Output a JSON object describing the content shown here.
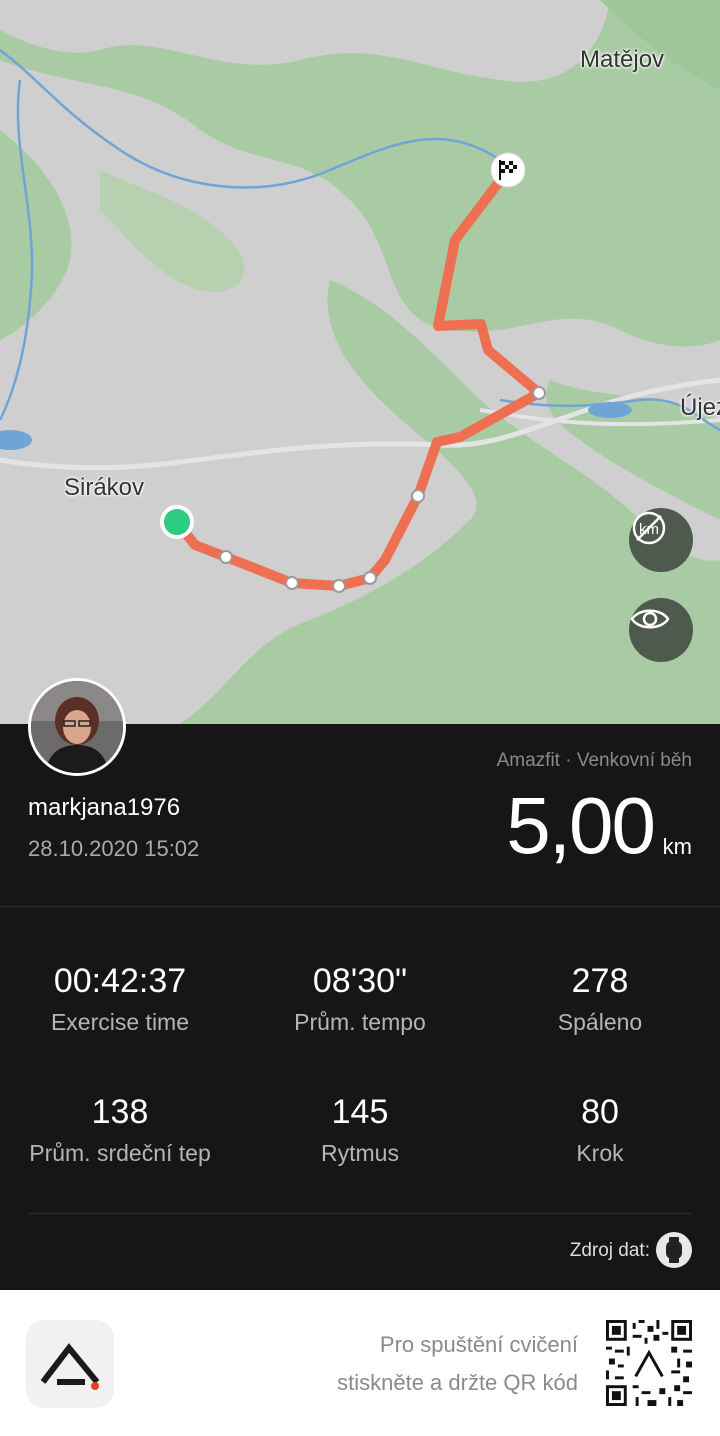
{
  "map": {
    "labels": {
      "matejov": "Matějov",
      "sirakov": "Sirákov",
      "ujezd": "Újez"
    },
    "route_color": "#ef6f52",
    "start_color": "#2ecc80",
    "finish_icon": "checkered-flag-icon",
    "buttons": {
      "km_toggle_icon": "km-markers-off-icon",
      "visibility_icon": "eye-icon"
    }
  },
  "profile": {
    "username": "markjana1976",
    "datetime": "28.10.2020 15:02",
    "device_activity": "Amazfit · Venkovní běh",
    "distance": "5,00",
    "distance_unit": "km"
  },
  "stats": [
    {
      "value": "00:42:37",
      "label": "Exercise time"
    },
    {
      "value": "08'30\"",
      "label": "Prům. tempo"
    },
    {
      "value": "278",
      "label": "Spáleno"
    },
    {
      "value": "138",
      "label": "Prům. srdeční tep"
    },
    {
      "value": "145",
      "label": "Rytmus"
    },
    {
      "value": "80",
      "label": "Krok"
    }
  ],
  "source": {
    "label": "Zdroj dat:",
    "icon": "watch-icon"
  },
  "footer": {
    "hint_line1": "Pro spuštění cvičení",
    "hint_line2": "stiskněte a držte QR kód",
    "logo_icon": "app-logo-icon",
    "qr_icon": "qr-code-icon"
  }
}
